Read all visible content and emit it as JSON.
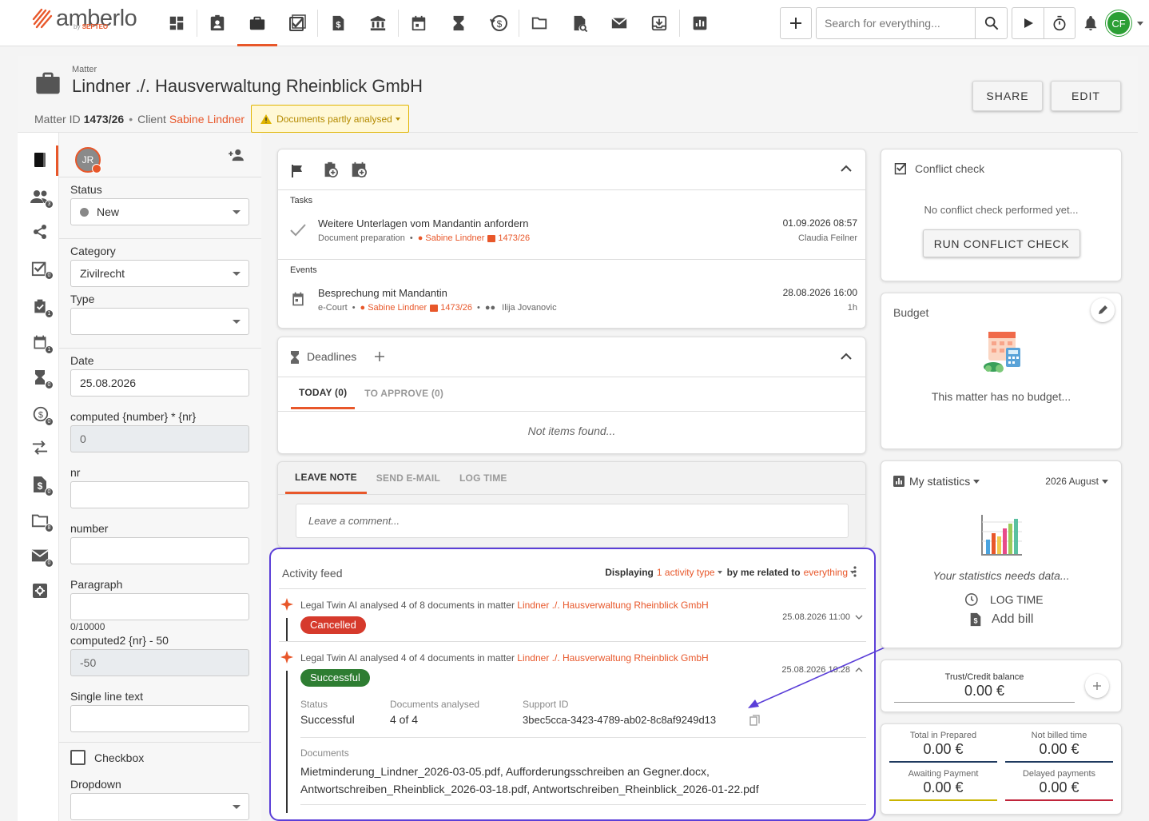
{
  "brand": {
    "name": "amberlo",
    "sub_prefix": "by",
    "sub_brand": "SEPTEO"
  },
  "topbar": {
    "search_placeholder": "Search for everything...",
    "user_initials": "CF",
    "nav_icons": [
      "dashboard-icon",
      "contacts-icon",
      "matters-icon",
      "tasks-icon",
      "billing-icon",
      "bank-icon",
      "calendar-icon",
      "deadlines-icon",
      "time-icon",
      "folder-icon",
      "documents-search-icon",
      "mail-icon",
      "inbox-icon",
      "reports-icon"
    ]
  },
  "matter": {
    "label": "Matter",
    "title": "Lindner ./. Hausverwaltung Rheinblick GmbH",
    "id_label": "Matter ID",
    "id": "1473/26",
    "client_label": "Client",
    "client": "Sabine Lindner",
    "badge": "Documents partly analysed",
    "share": "SHARE",
    "edit": "EDIT"
  },
  "rail": [
    {
      "icon": "notebook-icon",
      "badge": ""
    },
    {
      "icon": "people-icon",
      "badge": "3"
    },
    {
      "icon": "share-icon",
      "badge": ""
    },
    {
      "icon": "conflict-check-icon",
      "badge": "0"
    },
    {
      "icon": "task-check-icon",
      "badge": "1"
    },
    {
      "icon": "calendar-icon",
      "badge": "1"
    },
    {
      "icon": "hourglass-icon",
      "badge": "0"
    },
    {
      "icon": "time-money-icon",
      "badge": "0"
    },
    {
      "icon": "transfer-icon",
      "badge": ""
    },
    {
      "icon": "invoice-icon",
      "badge": "0"
    },
    {
      "icon": "folder-icon",
      "badge": "8"
    },
    {
      "icon": "mail-icon",
      "badge": "0"
    },
    {
      "icon": "settings-icon",
      "badge": ""
    }
  ],
  "form": {
    "avatar": "JR",
    "status_label": "Status",
    "status_value": "New",
    "category_label": "Category",
    "category_value": "Zivilrecht",
    "type_label": "Type",
    "type_value": "",
    "date_label": "Date",
    "date_value": "25.08.2026",
    "computed_label": "computed {number} * {nr}",
    "computed_value": "0",
    "nr_label": "nr",
    "nr_value": "",
    "number_label": "number",
    "number_value": "",
    "paragraph_label": "Paragraph",
    "paragraph_value": "",
    "paragraph_counter": "0/10000",
    "computed2_label": "computed2 {nr} - 50",
    "computed2_value": "-50",
    "singleline_label": "Single line text",
    "singleline_value": "",
    "checkbox_label": "Checkbox",
    "dropdown_label": "Dropdown",
    "dropdown_value": ""
  },
  "tasks_card": {
    "tasks_label": "Tasks",
    "task": {
      "title": "Weitere Unterlagen vom Mandantin anfordern",
      "category": "Document preparation",
      "person": "Sabine Lindner",
      "matter": "1473/26",
      "date": "01.09.2026 08:57",
      "assignee": "Claudia Feilner"
    },
    "events_label": "Events",
    "event": {
      "title": "Besprechung mit Mandantin",
      "category": "e-Court",
      "person": "Sabine Lindner",
      "matter": "1473/26",
      "attendee": "Ilija Jovanovic",
      "date": "28.08.2026 16:00",
      "duration": "1h"
    }
  },
  "deadlines": {
    "title": "Deadlines",
    "tab_today": "TODAY (0)",
    "tab_approve": "TO APPROVE (0)",
    "empty": "Not items found..."
  },
  "note": {
    "tab_leave": "LEAVE NOTE",
    "tab_email": "SEND E-MAIL",
    "tab_log": "LOG TIME",
    "placeholder": "Leave a comment..."
  },
  "feed": {
    "title": "Activity feed",
    "filter_prefix": "Displaying",
    "filter_type": "1 activity type",
    "filter_mid": "by me related to",
    "filter_scope": "everything",
    "items": [
      {
        "text": "Legal Twin AI analysed 4 of 8 documents in matter",
        "link": "Lindner ./. Hausverwaltung Rheinblick GmbH",
        "status": "Cancelled",
        "date": "25.08.2026 11:00"
      },
      {
        "text": "Legal Twin AI analysed 4 of 4 documents in matter",
        "link": "Lindner ./. Hausverwaltung Rheinblick GmbH",
        "status": "Successful",
        "date": "25.08.2026 10:28"
      }
    ],
    "detail": {
      "status_label": "Status",
      "status_value": "Successful",
      "docs_label": "Documents analysed",
      "docs_value": "4 of 4",
      "support_label": "Support ID",
      "support_value": "3bec5cca-3423-4789-ab02-8c8af9249d13",
      "documents_label": "Documents",
      "documents_line1": "Mietminderung_Lindner_2026-03-05.pdf, Aufforderungsschreiben an Gegner.docx,",
      "documents_line2": "Antwortschreiben_Rheinblick_2026-03-18.pdf, Antwortschreiben_Rheinblick_2026-01-22.pdf"
    }
  },
  "conflict": {
    "title": "Conflict check",
    "empty": "No conflict check performed yet...",
    "button": "RUN CONFLICT CHECK"
  },
  "budget": {
    "title": "Budget",
    "empty": "This matter has no budget..."
  },
  "stats": {
    "title": "My statistics",
    "period": "2026 August",
    "empty": "Your statistics needs data...",
    "log_time": "LOG TIME",
    "add_bill": "Add bill"
  },
  "trust": {
    "label": "Trust/Credit balance",
    "value": "0.00 €"
  },
  "balances": [
    {
      "label": "Total in Prepared",
      "value": "0.00 €",
      "color": "#1f3a5f"
    },
    {
      "label": "Not billed time",
      "value": "0.00 €",
      "color": "#1f3a5f"
    },
    {
      "label": "Awaiting Payment",
      "value": "0.00 €",
      "color": "#c9b400"
    },
    {
      "label": "Delayed payments",
      "value": "0.00 €",
      "color": "#c0243a"
    }
  ],
  "colors": {
    "accent": "#e8572a",
    "cancelled": "#d63a2c",
    "successful": "#2e7d32",
    "highlight": "#5b3fd8"
  }
}
